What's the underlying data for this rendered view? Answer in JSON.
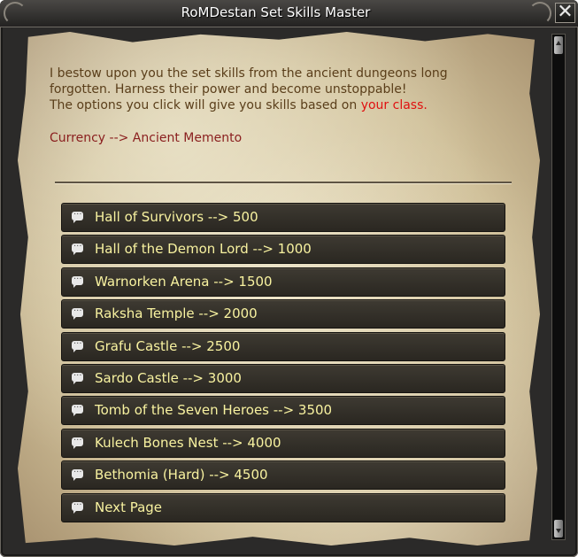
{
  "window": {
    "title": "RoMDestan Set Skills Master",
    "close_label": "✕"
  },
  "intro": {
    "line1": "I bestow upon you the set skills from the ancient dungeons long",
    "line2": "forgotten. Harness their power and become unstoppable!",
    "line3_prefix": "The options you click will give you skills based on ",
    "line3_highlight": "your class."
  },
  "currency": "Currency --> Ancient Memento",
  "options": [
    {
      "label": "Hall of Survivors --> 500"
    },
    {
      "label": "Hall of the Demon Lord --> 1000"
    },
    {
      "label": "Warnorken Arena --> 1500"
    },
    {
      "label": "Raksha Temple --> 2000"
    },
    {
      "label": "Grafu Castle --> 2500"
    },
    {
      "label": "Sardo Castle --> 3000"
    },
    {
      "label": "Tomb of the Seven Heroes --> 3500"
    },
    {
      "label": "Kulech Bones Nest --> 4000"
    },
    {
      "label": "Bethomia (Hard) --> 4500"
    },
    {
      "label": "Next Page"
    }
  ],
  "colors": {
    "option_text": "#f8f2a0",
    "intro_text": "#5a3e1a",
    "highlight": "#e01010",
    "currency_text": "#8a1e1e"
  },
  "icons": {
    "option_icon": "speech-bubble-icon",
    "close_icon": "close-icon"
  }
}
